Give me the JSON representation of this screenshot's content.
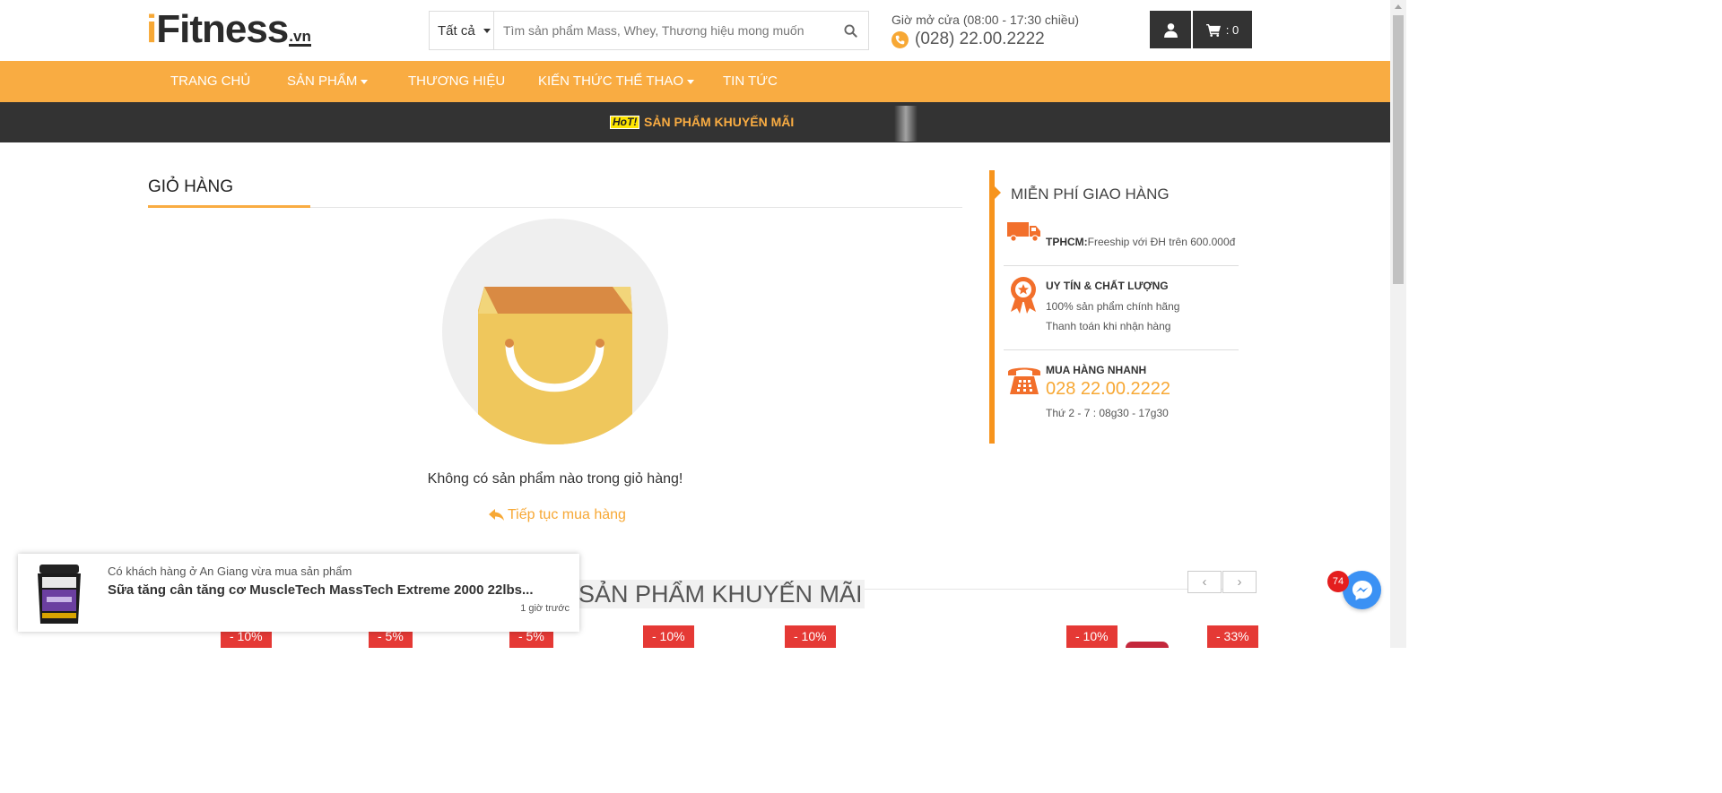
{
  "header": {
    "logo_i": "i",
    "logo_rest": "Fitness",
    "logo_vn": ".vn",
    "search_category": "Tất cả",
    "search_placeholder": "Tìm sản phẩm Mass, Whey, Thương hiệu mong muốn",
    "hours": "Giờ mở cửa (08:00 - 17:30 chiều)",
    "phone": "(028) 22.00.2222",
    "cart_count": ": 0"
  },
  "nav": {
    "items": [
      {
        "label": "TRANG CHỦ"
      },
      {
        "label": "SẢN PHẨM"
      },
      {
        "label": "THƯƠNG HIỆU"
      },
      {
        "label": "KIẾN THỨC THỂ THAO"
      },
      {
        "label": "TIN TỨC"
      }
    ]
  },
  "promo": {
    "hot": "HoT!",
    "text": "SẢN PHẨM KHUYẾN MÃI"
  },
  "cart": {
    "title": "GIỎ HÀNG",
    "empty_message": "Không có sản phẩm nào trong giỏ hàng!",
    "continue_label": "Tiếp tục mua hàng"
  },
  "sidebar": {
    "title": "MIỄN PHÍ GIAO HÀNG",
    "ship_bold": "TPHCM:",
    "ship_text": "Freeship với ĐH trên 600.000đ",
    "quality_title": "UY TÍN & CHẤT LƯỢNG",
    "quality_line1": "100% sản phẩm chính hãng",
    "quality_line2": "Thanh toán khi nhận hàng",
    "quick_title": "MUA HÀNG NHANH",
    "quick_phone": "028 22.00.2222",
    "quick_hours": "Thứ 2 - 7 : 08g30 - 17g30"
  },
  "promo_section": {
    "title": "SẢN PHẨM KHUYẾN MÃI",
    "prev": "‹",
    "next": "›",
    "badges": [
      "- 10%",
      "- 5%",
      "- 5%",
      "- 10%",
      "- 10%",
      "- 10%",
      "- 33%"
    ]
  },
  "notification": {
    "line1": "Có khách hàng ở An Giang vừa mua sản phẩm",
    "line2": "Sữa tăng cân tăng cơ MuscleTech MassTech Extreme 2000 22lbs...",
    "time": "1 giờ trước"
  },
  "messenger": {
    "count": "74"
  },
  "colors": {
    "accent": "#f9ac42",
    "dark": "#333333",
    "badge_red": "#e53935",
    "sidebar_orange": "#f7941d"
  }
}
